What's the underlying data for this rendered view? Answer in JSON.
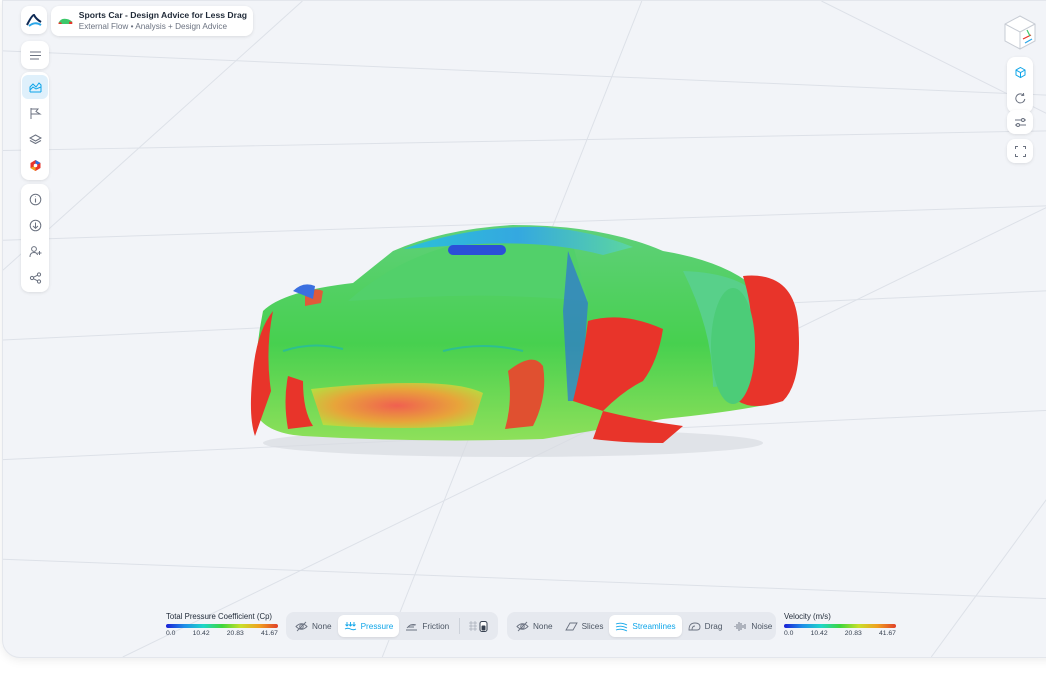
{
  "project": {
    "title": "Sports Car - Design Advice for Less Drag",
    "subtitle": "External Flow • Analysis + Design Advice"
  },
  "icons": {
    "logo": "app-logo-icon",
    "menu": "menu-icon",
    "left_group_1": [
      "surface-results-icon",
      "flag-icon",
      "layers-icon",
      "multi-color-icon"
    ],
    "left_group_2": [
      "info-icon",
      "download-icon",
      "add-user-icon",
      "share-icon"
    ],
    "right": [
      "view-cube-icon",
      "cube-icon",
      "rotate-icon",
      "settings-sliders-icon",
      "fullscreen-icon"
    ]
  },
  "surface_legend": {
    "title": "Total Pressure Coefficient (Cp)",
    "ticks": [
      "0.0",
      "10.42",
      "20.83",
      "41.67"
    ]
  },
  "surface_toggle": {
    "items": [
      {
        "label": "None",
        "icon": "eye-off-icon",
        "active": false
      },
      {
        "label": "Pressure",
        "icon": "pressure-icon",
        "active": true
      },
      {
        "label": "Friction",
        "icon": "friction-icon",
        "active": false
      }
    ],
    "extra_icon": "mesh-toggle-icon"
  },
  "flow_toggle": {
    "items": [
      {
        "label": "None",
        "icon": "eye-off-icon",
        "active": false
      },
      {
        "label": "Slices",
        "icon": "slices-icon",
        "active": false
      },
      {
        "label": "Streamlines",
        "icon": "streamlines-icon",
        "active": true
      },
      {
        "label": "Drag",
        "icon": "drag-icon",
        "active": false
      },
      {
        "label": "Noise",
        "icon": "noise-icon",
        "active": false
      }
    ]
  },
  "velocity_legend": {
    "title": "Velocity (m/s)",
    "ticks": [
      "0.0",
      "10.42",
      "20.83",
      "41.67"
    ]
  },
  "colors": {
    "accent": "#0ea5e9",
    "legend_gradient": [
      "#1b1fd6",
      "#1e8fe8",
      "#1fd6c8",
      "#3dd63d",
      "#c8e02a",
      "#f0a020",
      "#e0402a"
    ]
  }
}
